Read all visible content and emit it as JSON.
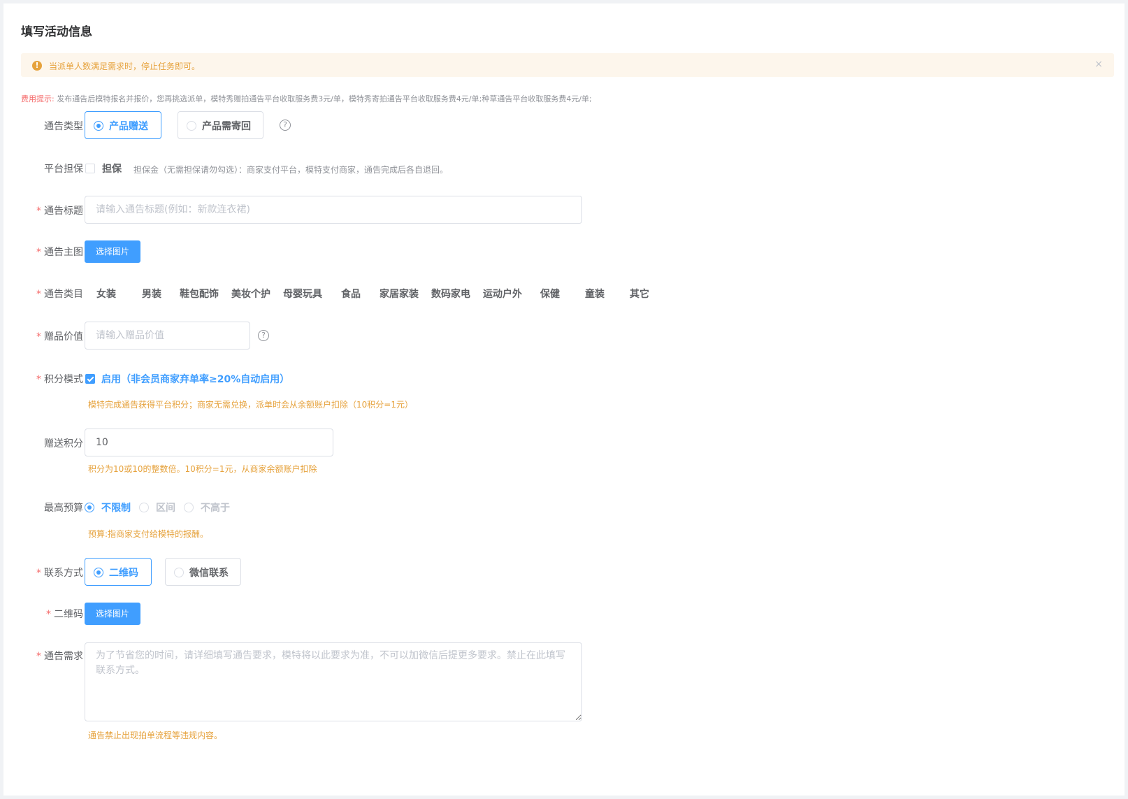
{
  "page": {
    "title": "填写活动信息"
  },
  "alert": {
    "text": "当派单人数满足需求时，停止任务即可。",
    "close": "×"
  },
  "fee_tip": {
    "label": "费用提示:",
    "text": "发布通告后模特报名并报价，您再挑选派单，模特秀赠拍通告平台收取服务费3元/单，模特秀寄拍通告平台收取服务费4元/单;种草通告平台收取服务费4元/单;"
  },
  "form": {
    "required_mark": "*",
    "notice_type": {
      "label": "通告类型",
      "options": [
        "产品赠送",
        "产品需寄回"
      ],
      "selected": "产品赠送",
      "help": "?"
    },
    "guarantee": {
      "label": "平台担保",
      "checkbox_label": "担保",
      "checked": false,
      "note": "担保金（无需担保请勿勾选）：商家支付平台，模特支付商家，通告完成后各自退回。"
    },
    "title": {
      "label": "通告标题",
      "placeholder": "请输入通告标题(例如：新款连衣裙)",
      "value": ""
    },
    "main_image": {
      "label": "通告主图",
      "button": "选择图片"
    },
    "category": {
      "label": "通告类目",
      "items": [
        "女装",
        "男装",
        "鞋包配饰",
        "美妆个护",
        "母婴玩具",
        "食品",
        "家居家装",
        "数码家电",
        "运动户外",
        "保健",
        "童装",
        "其它"
      ]
    },
    "gift_value": {
      "label": "赠品价值",
      "placeholder": "请输入赠品价值",
      "help": "?"
    },
    "points_mode": {
      "label": "积分模式",
      "checkbox_label": "启用（非会员商家弃单率≥20%自动启用）",
      "checked": true,
      "hint": "模特完成通告获得平台积分；商家无需兑换，派单时会从余额账户扣除（10积分=1元）"
    },
    "gift_points": {
      "label": "赠送积分",
      "value": "10",
      "hint": "积分为10或10的整数倍。10积分=1元，从商家余额账户扣除"
    },
    "max_budget": {
      "label": "最高预算",
      "options": [
        "不限制",
        "区间",
        "不高于"
      ],
      "selected": "不限制",
      "hint": "预算:指商家支付给模特的报酬。"
    },
    "contact": {
      "label": "联系方式",
      "options": [
        "二维码",
        "微信联系"
      ],
      "selected": "二维码"
    },
    "qrcode": {
      "label": "二维码",
      "button": "选择图片"
    },
    "requirements": {
      "label": "通告需求",
      "placeholder": "为了节省您的时间，请详细填写通告要求，模特将以此要求为准，不可以加微信后提更多要求。禁止在此填写联系方式。",
      "hint": "通告禁止出现拍单流程等违规内容。"
    }
  },
  "colors": {
    "primary": "#409eff",
    "warning": "#e6a23c",
    "danger": "#f56c6c",
    "alert_bg": "#fdf6ec"
  }
}
